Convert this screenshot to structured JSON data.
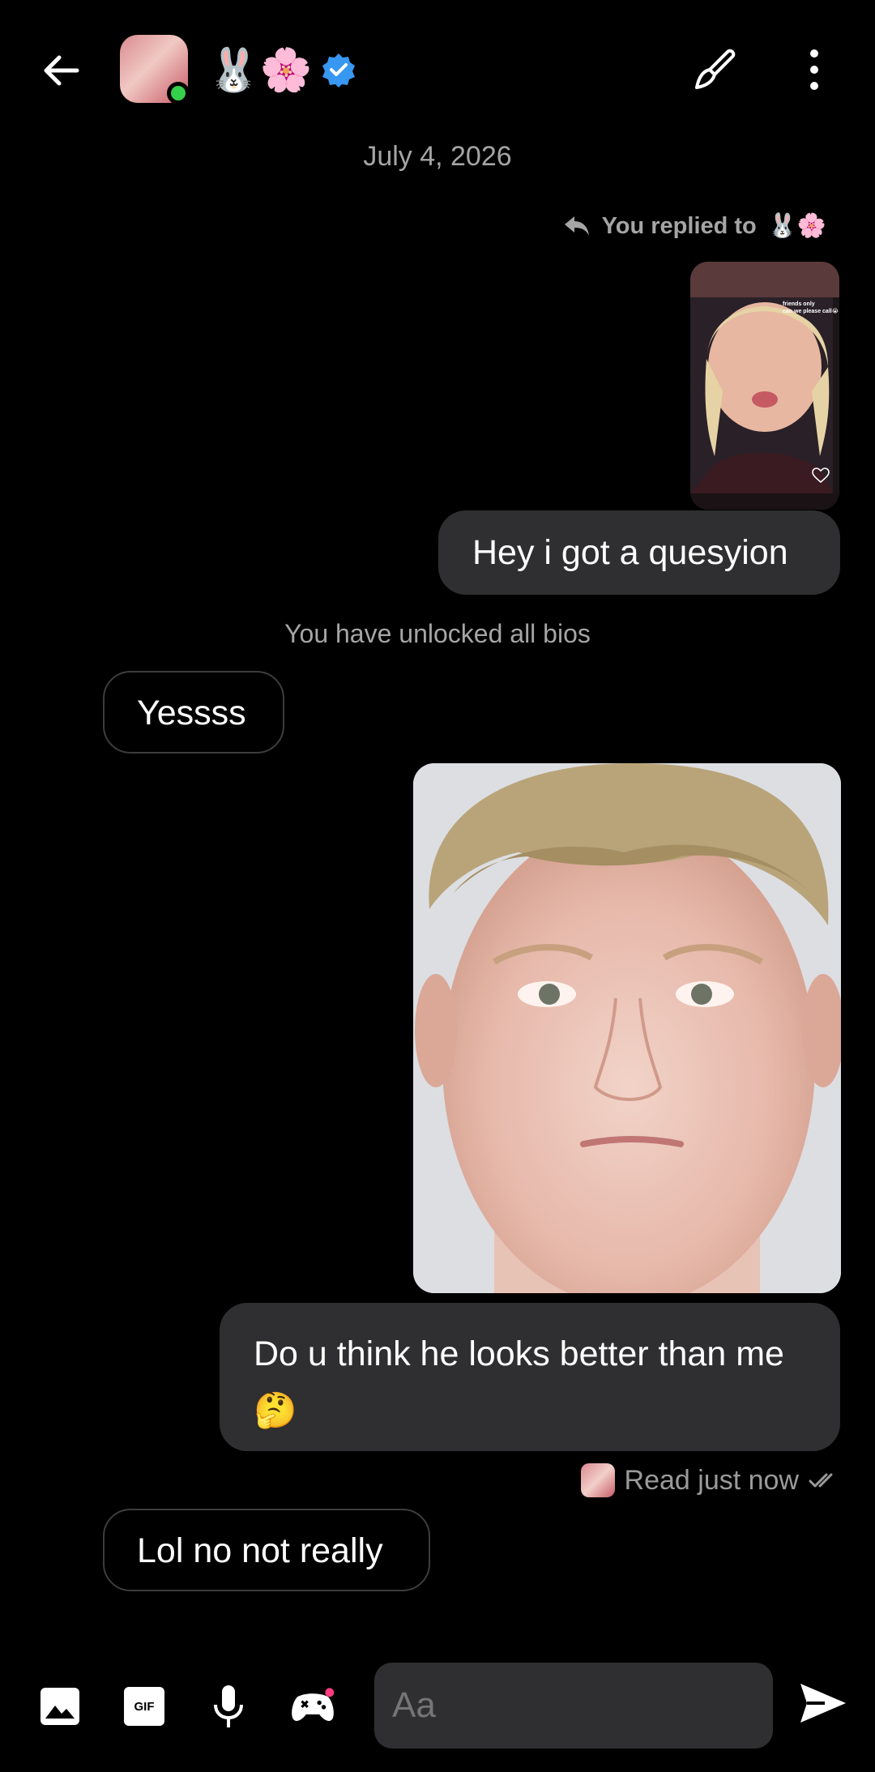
{
  "header": {
    "contact_emoji": "🐰🌸"
  },
  "date_label": "July 4, 2026",
  "reply_label": "You replied to",
  "reply_emoji": "🐰🌸",
  "story_overlay": {
    "line1": "friends only",
    "line2": "can we please call😭"
  },
  "messages": {
    "m1": "Hey i got a quesyion",
    "system": "You have unlocked all bios",
    "m2": "Yessss",
    "m3": "Do u think he looks better than me 🤔",
    "m4": "Lol no not really"
  },
  "read_status": "Read just now",
  "composer": {
    "placeholder": "Aa",
    "gif_label": "GIF"
  },
  "colors": {
    "online": "#35d04b",
    "verified": "#3897f0",
    "bubble_out": "#2f2f31",
    "notification_dot": "#ff3b7f"
  }
}
